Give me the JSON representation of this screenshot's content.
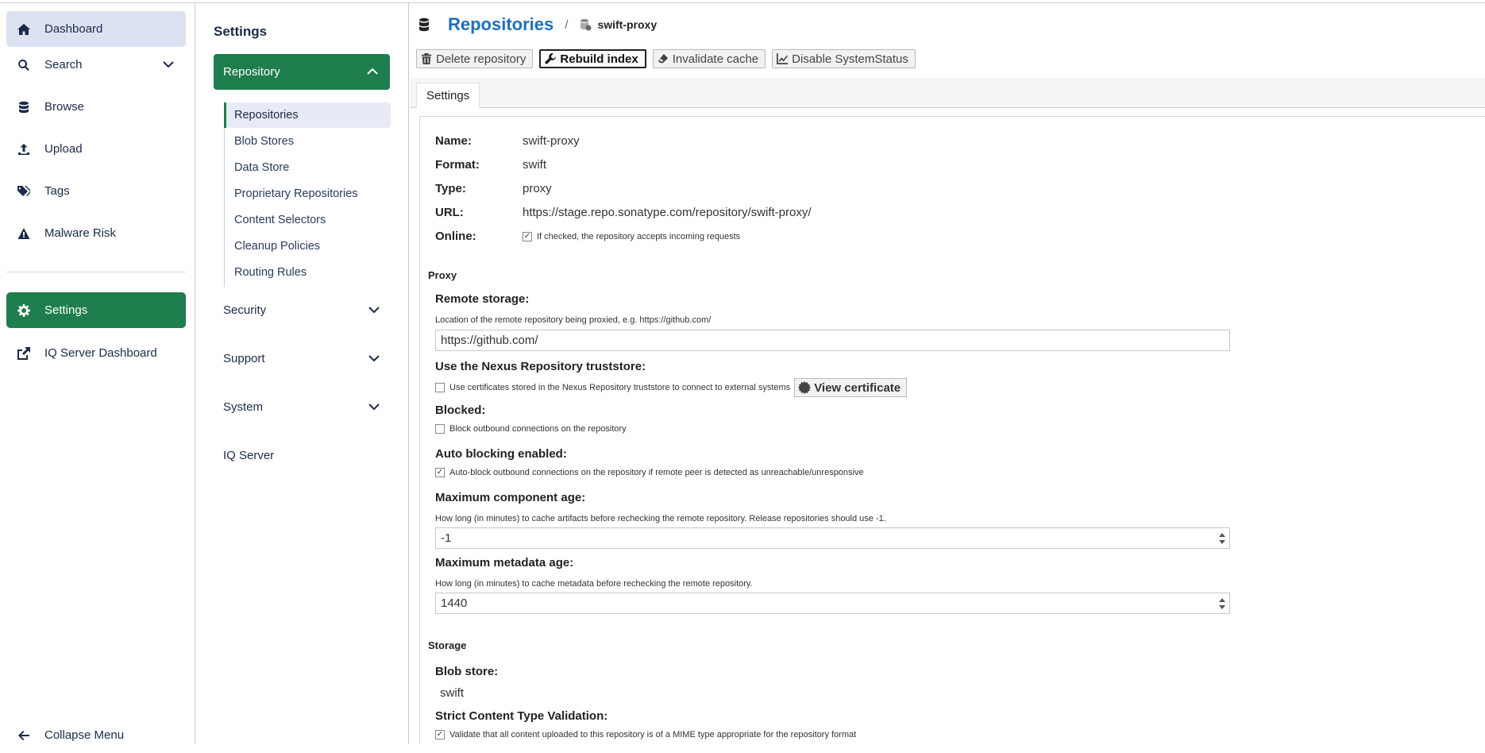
{
  "nav": {
    "items": [
      {
        "label": "Dashboard",
        "icon": "home-icon"
      },
      {
        "label": "Search",
        "icon": "search-icon"
      },
      {
        "label": "Browse",
        "icon": "database-icon"
      },
      {
        "label": "Upload",
        "icon": "upload-icon"
      },
      {
        "label": "Tags",
        "icon": "tags-icon"
      },
      {
        "label": "Malware Risk",
        "icon": "warning-icon"
      },
      {
        "label": "Settings",
        "icon": "gear-icon"
      },
      {
        "label": "IQ Server Dashboard",
        "icon": "external-link-icon"
      }
    ],
    "collapse_label": "Collapse Menu"
  },
  "settings_panel": {
    "title": "Settings",
    "repository_group": "Repository",
    "repository_items": [
      "Repositories",
      "Blob Stores",
      "Data Store",
      "Proprietary Repositories",
      "Content Selectors",
      "Cleanup Policies",
      "Routing Rules"
    ],
    "groups": [
      "Security",
      "Support",
      "System",
      "IQ Server"
    ]
  },
  "header": {
    "title": "Repositories",
    "separator": "/",
    "current": "swift-proxy"
  },
  "toolbar": {
    "delete_label": "Delete repository",
    "rebuild_label": "Rebuild index",
    "invalidate_label": "Invalidate cache",
    "disable_label": "Disable SystemStatus"
  },
  "tabs": {
    "settings": "Settings"
  },
  "summary": {
    "name_label": "Name:",
    "name": "swift-proxy",
    "format_label": "Format:",
    "format": "swift",
    "type_label": "Type:",
    "type": "proxy",
    "url_label": "URL:",
    "url": "https://stage.repo.sonatype.com/repository/swift-proxy/",
    "online_label": "Online:",
    "online_help": "If checked, the repository accepts incoming requests"
  },
  "proxy": {
    "section": "Proxy",
    "remote_label": "Remote storage:",
    "remote_help": "Location of the remote repository being proxied, e.g. https://github.com/",
    "remote_value": "https://github.com/",
    "truststore_label": "Use the Nexus Repository truststore:",
    "truststore_help": "Use certificates stored in the Nexus Repository truststore to connect to external systems",
    "view_cert": "View certificate",
    "blocked_label": "Blocked:",
    "blocked_help": "Block outbound connections on the repository",
    "autoblock_label": "Auto blocking enabled:",
    "autoblock_help": "Auto-block outbound connections on the repository if remote peer is detected as unreachable/unresponsive",
    "max_component_label": "Maximum component age:",
    "max_component_help": "How long (in minutes) to cache artifacts before rechecking the remote repository. Release repositories should use -1.",
    "max_component_value": "-1",
    "max_metadata_label": "Maximum metadata age:",
    "max_metadata_help": "How long (in minutes) to cache metadata before rechecking the remote repository.",
    "max_metadata_value": "1440"
  },
  "storage": {
    "section": "Storage",
    "blob_label": "Blob store:",
    "blob_value": "swift",
    "strict_label": "Strict Content Type Validation:",
    "strict_help": "Validate that all content uploaded to this repository is of a MIME type appropriate for the repository format"
  },
  "colors": {
    "accent_green": "#1e7e4d",
    "link_blue": "#1d6fb8",
    "nav_active": "#dde2f3"
  }
}
